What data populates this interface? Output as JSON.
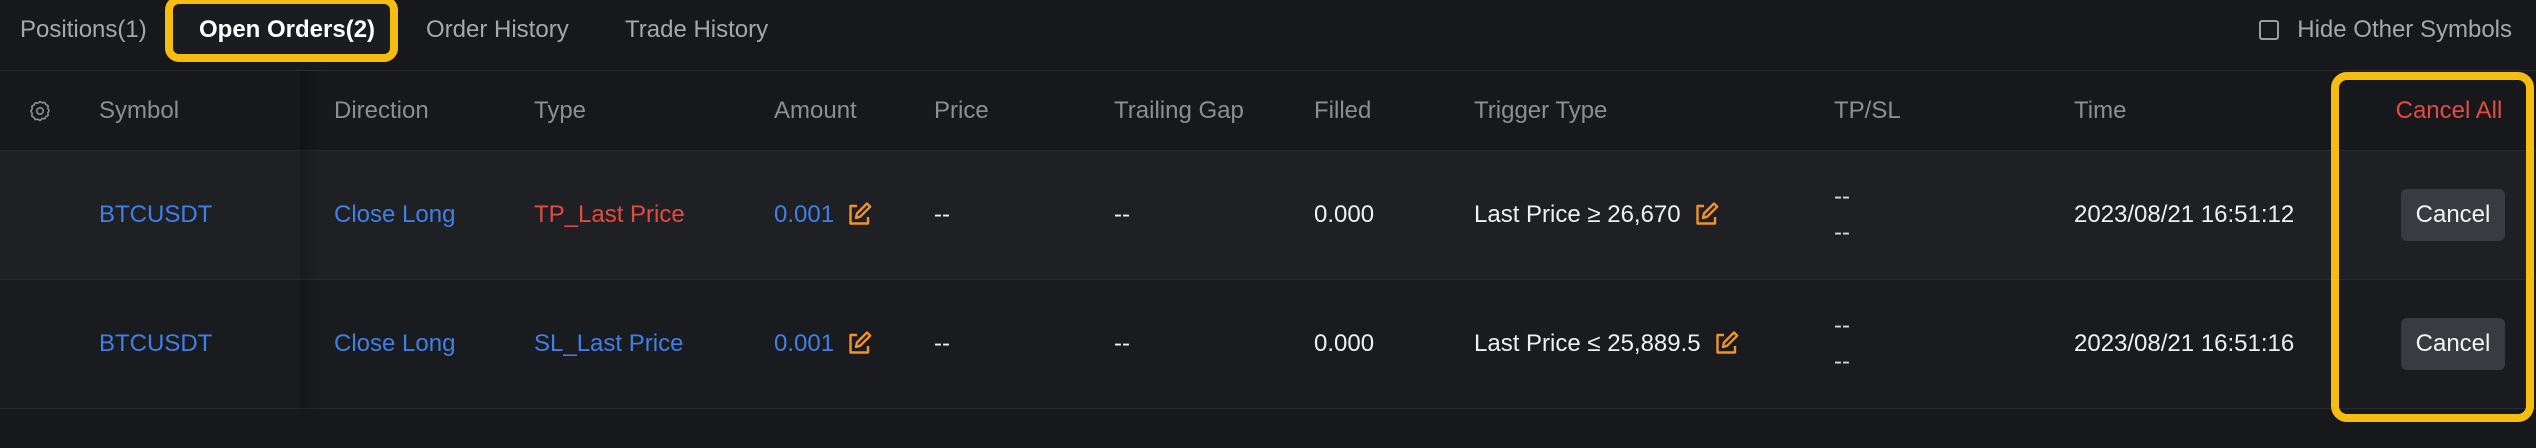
{
  "tabs": [
    {
      "label": "Positions(1)"
    },
    {
      "label": "Open Orders(2)"
    },
    {
      "label": "Order History"
    },
    {
      "label": "Trade History"
    }
  ],
  "hide_other_symbols": {
    "label": "Hide Other Symbols",
    "checked": false
  },
  "table": {
    "headers": {
      "symbol": "Symbol",
      "direction": "Direction",
      "type": "Type",
      "amount": "Amount",
      "price": "Price",
      "trailing_gap": "Trailing Gap",
      "filled": "Filled",
      "trigger_type": "Trigger Type",
      "tpsl": "TP/SL",
      "time": "Time",
      "cancel_all": "Cancel All"
    },
    "rows": [
      {
        "symbol": "BTCUSDT",
        "direction": "Close Long",
        "type": "TP_Last Price",
        "amount": "0.001",
        "price": "--",
        "trailing_gap": "--",
        "filled": "0.000",
        "trigger_type": "Last Price ≥ 26,670",
        "tp": "--",
        "sl": "--",
        "time": "2023/08/21 16:51:12",
        "cancel_label": "Cancel"
      },
      {
        "symbol": "BTCUSDT",
        "direction": "Close Long",
        "type": "SL_Last Price",
        "amount": "0.001",
        "price": "--",
        "trailing_gap": "--",
        "filled": "0.000",
        "trigger_type": "Last Price ≤ 25,889.5",
        "tp": "--",
        "sl": "--",
        "time": "2023/08/21 16:51:16",
        "cancel_label": "Cancel"
      }
    ]
  },
  "colors": {
    "background": "#17181b",
    "highlight": "#f5bd12",
    "link_blue": "#3f7fe8",
    "sell_red": "#e24b44",
    "edit_orange": "#f0932b"
  },
  "icons": {
    "settings": "gear-icon",
    "edit": "edit-icon"
  }
}
